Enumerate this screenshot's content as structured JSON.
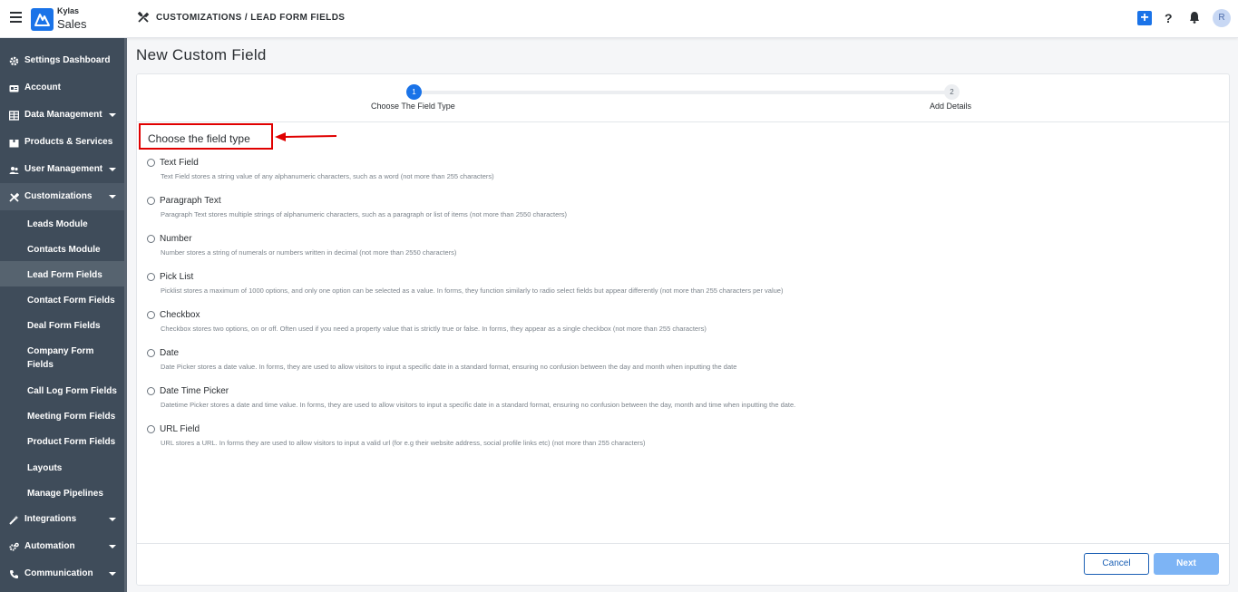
{
  "app": {
    "brand_top": "Kylas",
    "brand_bottom": "Sales"
  },
  "header": {
    "breadcrumb": "CUSTOMIZATIONS / LEAD FORM FIELDS",
    "help": "?",
    "plus": "+",
    "avatar": "R"
  },
  "sidebar": {
    "items": [
      {
        "label": "Settings Dashboard",
        "icon": "gear-icon"
      },
      {
        "label": "Account",
        "icon": "id-card-icon"
      },
      {
        "label": "Data Management",
        "icon": "table-icon"
      },
      {
        "label": "Products & Services",
        "icon": "box-icon"
      },
      {
        "label": "User Management",
        "icon": "users-icon"
      },
      {
        "label": "Customizations",
        "icon": "tools-icon"
      }
    ],
    "sub_items": [
      {
        "label": "Leads Module"
      },
      {
        "label": "Contacts Module"
      },
      {
        "label": "Lead Form Fields"
      },
      {
        "label": "Contact Form Fields"
      },
      {
        "label": "Deal Form Fields"
      },
      {
        "label": "Company Form Fields"
      },
      {
        "label": "Call Log Form Fields"
      },
      {
        "label": "Meeting Form Fields"
      },
      {
        "label": "Product Form Fields"
      },
      {
        "label": "Layouts"
      },
      {
        "label": "Manage Pipelines"
      }
    ],
    "bottom_items": [
      {
        "label": "Integrations",
        "icon": "wand-icon"
      },
      {
        "label": "Automation",
        "icon": "cogs-icon"
      },
      {
        "label": "Communication",
        "icon": "phone-icon"
      }
    ]
  },
  "main": {
    "title": "New Custom Field",
    "steps": [
      {
        "number": "1",
        "label": "Choose The Field Type"
      },
      {
        "number": "2",
        "label": "Add Details"
      }
    ],
    "section_title": "Choose the field type",
    "options": [
      {
        "name": "Text Field",
        "desc": "Text Field stores a string value of any alphanumeric characters, such as a word (not more than 255 characters)"
      },
      {
        "name": "Paragraph Text",
        "desc": "Paragraph Text stores multiple strings of alphanumeric characters, such as a paragraph or list of items (not more than 2550 characters)"
      },
      {
        "name": "Number",
        "desc": "Number stores a string of numerals or numbers written in decimal (not more than 2550 characters)"
      },
      {
        "name": "Pick List",
        "desc": "Picklist stores a maximum of 1000 options, and only one option can be selected as a value. In forms, they function similarly to radio select fields but appear differently (not more than 255 characters per value)"
      },
      {
        "name": "Checkbox",
        "desc": "Checkbox stores two options, on or off. Often used if you need a property value that is strictly true or false. In forms, they appear as a single checkbox (not more than 255 characters)"
      },
      {
        "name": "Date",
        "desc": "Date Picker stores a date value. In forms, they are used to allow visitors to input a specific date in a standard format, ensuring no confusion between the day and month when inputting the date"
      },
      {
        "name": "Date Time Picker",
        "desc": "Datetime Picker stores a date and time value. In forms, they are used to allow visitors to input a specific date in a standard format, ensuring no confusion between the day, month and time when inputting the date."
      },
      {
        "name": "URL Field",
        "desc": "URL stores a URL. In forms they are used to allow visitors to input a valid url (for e.g their website address, social profile links etc) (not more than 255 characters)"
      }
    ],
    "buttons": {
      "cancel": "Cancel",
      "next": "Next"
    }
  },
  "colors": {
    "accent": "#1a73e8",
    "sidebar": "#3f4c5a",
    "highlight": "#e00000"
  }
}
